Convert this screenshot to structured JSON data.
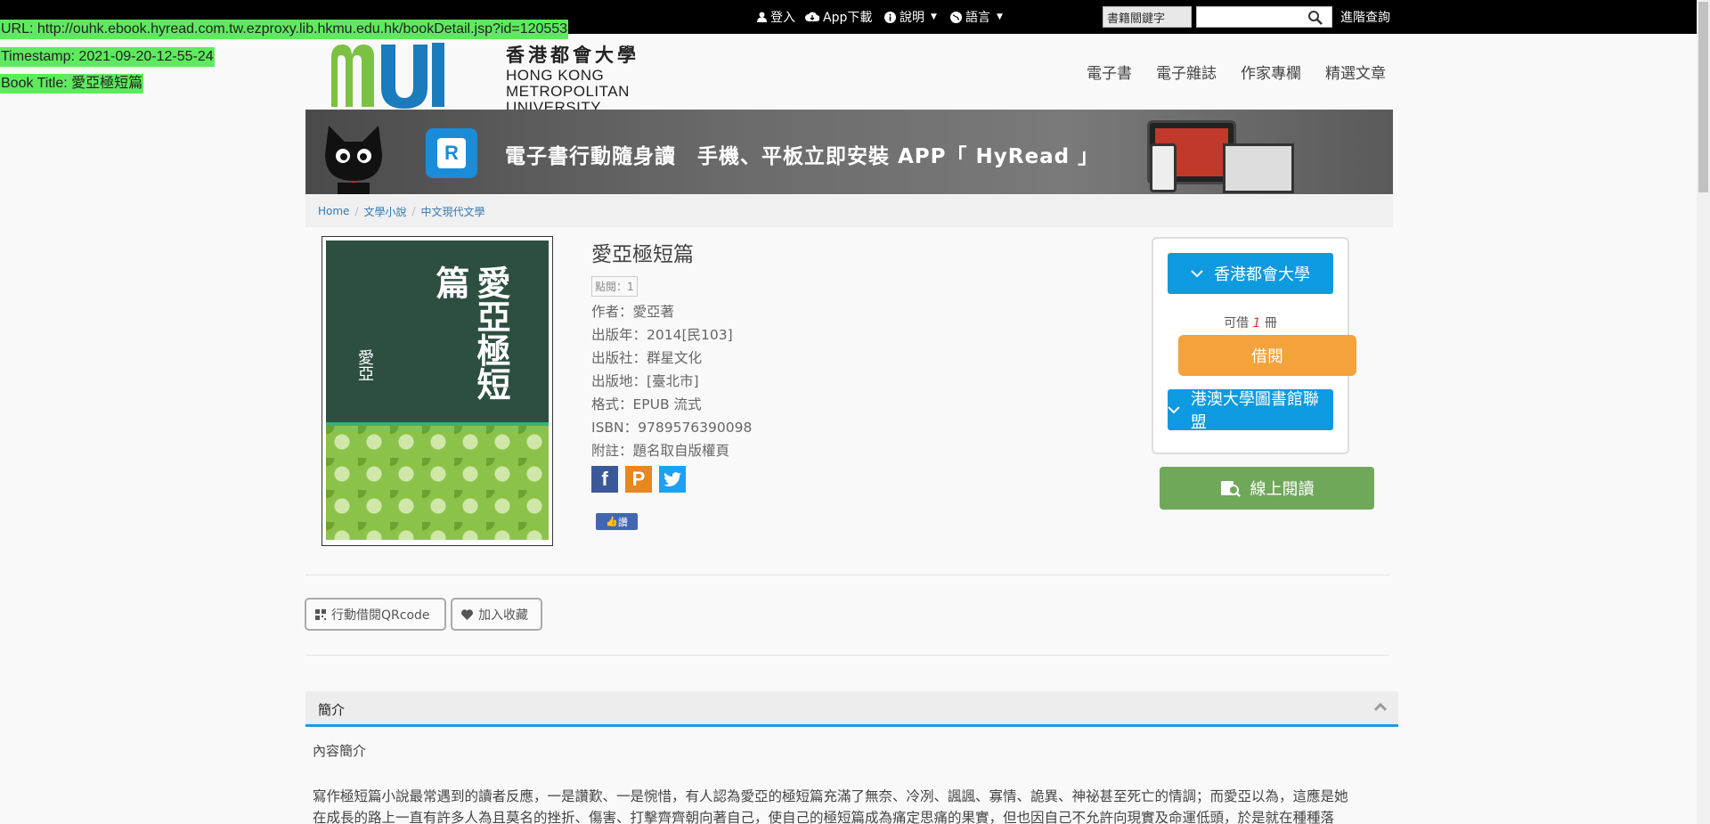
{
  "overlay": {
    "url": "URL: http://ouhk.ebook.hyread.com.tw.ezproxy.lib.hkmu.edu.hk/bookDetail.jsp?id=120553",
    "timestamp": "Timestamp: 2021-09-20-12-55-24",
    "book_title": "Book Title: 愛亞極短篇"
  },
  "topbar": {
    "login": "登入",
    "app_download": "App下載",
    "help": "說明",
    "language": "語言",
    "search_select": "書籍關鍵字",
    "search_placeholder": "",
    "advanced_search": "進階查詢"
  },
  "header": {
    "logo_cn": "香港都會大學",
    "logo_en_1": "HONG KONG",
    "logo_en_2": "METROPOLITAN",
    "logo_en_3": "UNIVERSITY",
    "nav": [
      "電子書",
      "電子雜誌",
      "作家專欄",
      "精選文章"
    ]
  },
  "banner": {
    "text": "電子書行動隨身讀　手機、平板立即安裝 APP「 HyRead 」"
  },
  "breadcrumb": [
    "Home",
    "文學小說",
    "中文現代文學"
  ],
  "cover": {
    "title": "愛亞極短篇",
    "author": "愛亞"
  },
  "book": {
    "title": "愛亞極短篇",
    "clicks": "點閱：1",
    "author": "作者：愛亞著",
    "year": "出版年：2014[民103]",
    "publisher": "出版社：群星文化",
    "place": "出版地：[臺北市]",
    "format": "格式：EPUB 流式",
    "isbn": "ISBN：9789576390098",
    "note": "附註：題名取自版權頁",
    "fb_like": "讚"
  },
  "panel": {
    "library": "香港都會大學",
    "avail_prefix": "可借",
    "avail_count": "1",
    "avail_suffix": "冊",
    "borrow": "借閱",
    "alliance": "港澳大學圖書館聯盟",
    "read_online": "線上閱讀"
  },
  "actions": {
    "qr": "行動借閱QRcode",
    "fav": "加入收藏"
  },
  "intro": {
    "header": "簡介",
    "subheader": "內容簡介",
    "line1": "寫作極短篇小說最常遇到的讀者反應，一是讚歎、一是惋惜，有人認為愛亞的極短篇充滿了無奈、冷冽、諷諷、寡情、詭異、神祕甚至死亡的情調；而愛亞以為，這應是她",
    "line2": "在成長的路上一直有許多人為且莫名的挫折、傷害、打擊齊齊朝向著自己，使自己的極短篇成為痛定思痛的果實，但也因自己不允許向現實及命運低頭，於是就在種種落"
  },
  "colors": {
    "blue": "#0d9ae0",
    "orange": "#f4a23c",
    "green": "#70a85a",
    "overlay": "#5eea5e"
  }
}
